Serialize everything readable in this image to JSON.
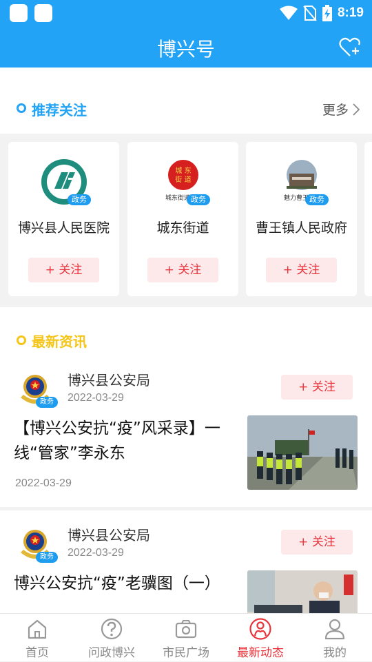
{
  "status_bar": {
    "time": "8:19",
    "icons": [
      "notification-icon",
      "notification-icon",
      "wifi-icon",
      "no-sim-icon",
      "battery-charging-icon"
    ]
  },
  "header": {
    "title": "博兴号",
    "fav_icon": "heart-plus-icon"
  },
  "recommend": {
    "title": "推荐关注",
    "more": "更多",
    "accent": "#22a3f5",
    "items": [
      {
        "name": "博兴县人民医院",
        "badge": "政务",
        "follow": "+ 关注"
      },
      {
        "name": "城东街道",
        "badge": "政务",
        "follow": "+ 关注",
        "logo_text": "城东街道"
      },
      {
        "name": "曹王镇人民政府",
        "badge": "政务",
        "follow": "+ 关注",
        "logo_text": "魅力曹王"
      }
    ]
  },
  "news": {
    "title": "最新资讯",
    "accent": "#f5c518",
    "items": [
      {
        "source": "博兴县公安局",
        "badge": "政务",
        "source_date": "2022-03-29",
        "follow": "+ 关注",
        "title": "【博兴公安抗“疫”风采录】一线“管家”李永东",
        "date": "2022-03-29"
      },
      {
        "source": "博兴县公安局",
        "badge": "政务",
        "source_date": "2022-03-29",
        "follow": "+ 关注",
        "title": "博兴公安抗“疫”老骥图（一）"
      }
    ]
  },
  "tabbar": {
    "active_color": "#e8333b",
    "items": [
      {
        "label": "首页",
        "icon": "home-icon"
      },
      {
        "label": "问政博兴",
        "icon": "question-icon"
      },
      {
        "label": "市民广场",
        "icon": "camera-icon"
      },
      {
        "label": "最新动态",
        "icon": "activity-icon",
        "active": true
      },
      {
        "label": "我的",
        "icon": "user-icon"
      }
    ]
  }
}
